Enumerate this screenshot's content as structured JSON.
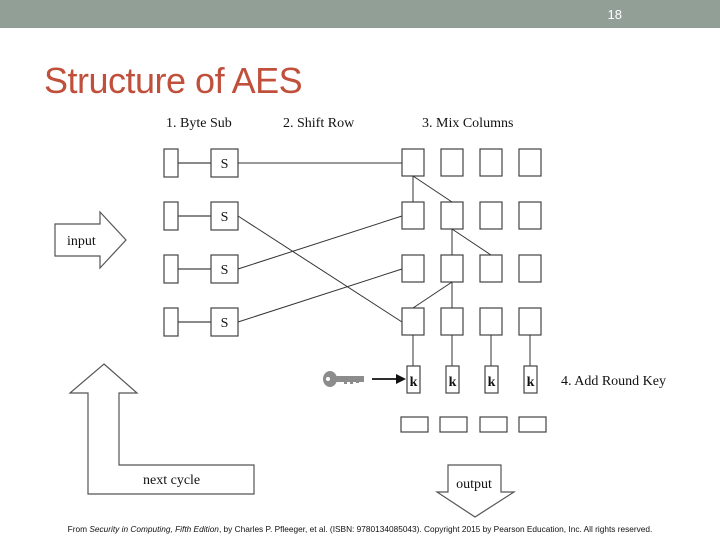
{
  "header": {
    "slide_number": "18",
    "bar_color": "#929f96"
  },
  "title": "Structure of AES",
  "title_color": "#c0503c",
  "diagram": {
    "step_labels": {
      "byte_sub": "1.  Byte Sub",
      "shift_row": "2.  Shift Row",
      "mix_columns": "3.  Mix Columns",
      "add_round_key": "4.  Add Round Key"
    },
    "sbox_label": "S",
    "key_box_label": "k",
    "input_label": "input",
    "output_label": "output",
    "next_cycle_label": "next  cycle",
    "sbox_rows": 4,
    "grid_columns": 4,
    "key_icon": "key-icon"
  },
  "footer": {
    "prefix": "From ",
    "book_title": "Security in Computing, Fifth Edition",
    "suffix": ", by Charles P. Pfleeger, et al. (ISBN: 9780134085043). Copyright 2015 by Pearson Education, Inc. All rights reserved."
  }
}
